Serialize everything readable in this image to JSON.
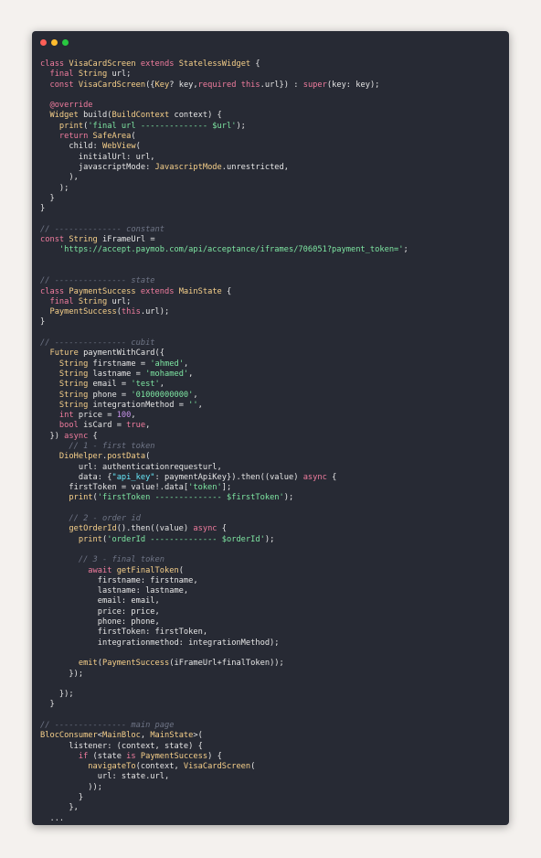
{
  "window": {
    "controls": [
      {
        "name": "close-dot",
        "color": "#ff5f57"
      },
      {
        "name": "minimize-dot",
        "color": "#febc2e"
      },
      {
        "name": "maximize-dot",
        "color": "#28c840"
      }
    ]
  },
  "colors": {
    "background": "#f4f1ee",
    "editor": "#272a34",
    "keyword": "#f07c9e",
    "type": "#f7d08a",
    "string": "#7ee6a2",
    "string_alt": "#67e8f9",
    "comment": "#6f7586",
    "number": "#c792ea",
    "plain": "#e6e6e6"
  },
  "code": {
    "lines": [
      [
        [
          "k",
          "class "
        ],
        [
          "t",
          "VisaCardScreen "
        ],
        [
          "k",
          "extends "
        ],
        [
          "t",
          "StatelessWidget "
        ],
        [
          "d",
          "{"
        ]
      ],
      [
        [
          "k",
          "  final "
        ],
        [
          "t",
          "String "
        ],
        [
          "d",
          "url;"
        ]
      ],
      [
        [
          "k",
          "  const "
        ],
        [
          "t",
          "VisaCardScreen"
        ],
        [
          "d",
          "({"
        ],
        [
          "t",
          "Key"
        ],
        [
          "d",
          "? key,"
        ],
        [
          "k",
          "required this"
        ],
        [
          "d",
          ".url}) : "
        ],
        [
          "k",
          "super"
        ],
        [
          "d",
          "(key: key);"
        ]
      ],
      [],
      [
        [
          "k",
          "  @override"
        ]
      ],
      [
        [
          "t",
          "  Widget "
        ],
        [
          "d",
          "build("
        ],
        [
          "t",
          "BuildContext "
        ],
        [
          "d",
          "context) {"
        ]
      ],
      [
        [
          "t",
          "    print"
        ],
        [
          "d",
          "("
        ],
        [
          "s",
          "'final url -------------- $url'"
        ],
        [
          "d",
          ");"
        ]
      ],
      [
        [
          "k",
          "    return "
        ],
        [
          "t",
          "SafeArea"
        ],
        [
          "d",
          "("
        ]
      ],
      [
        [
          "d",
          "      child: "
        ],
        [
          "t",
          "WebView"
        ],
        [
          "d",
          "("
        ]
      ],
      [
        [
          "d",
          "        initialUrl: url,"
        ]
      ],
      [
        [
          "d",
          "        javascriptMode: "
        ],
        [
          "t",
          "JavascriptMode"
        ],
        [
          "d",
          ".unrestricted,"
        ]
      ],
      [
        [
          "d",
          "      ),"
        ]
      ],
      [
        [
          "d",
          "    );"
        ]
      ],
      [
        [
          "d",
          "  }"
        ]
      ],
      [
        [
          "d",
          "}"
        ]
      ],
      [],
      [
        [
          "c",
          "// -------------- constant"
        ]
      ],
      [
        [
          "k",
          "const "
        ],
        [
          "t",
          "String "
        ],
        [
          "d",
          "iFrameUrl ="
        ]
      ],
      [
        [
          "s",
          "    'https://accept.paymob.com/api/acceptance/iframes/706051?payment_token='"
        ],
        [
          "d",
          ";"
        ]
      ],
      [],
      [],
      [
        [
          "c",
          "// --------------- state"
        ]
      ],
      [
        [
          "k",
          "class "
        ],
        [
          "t",
          "PaymentSuccess "
        ],
        [
          "k",
          "extends "
        ],
        [
          "t",
          "MainState "
        ],
        [
          "d",
          "{"
        ]
      ],
      [
        [
          "k",
          "  final "
        ],
        [
          "t",
          "String "
        ],
        [
          "d",
          "url;"
        ]
      ],
      [
        [
          "t",
          "  PaymentSuccess"
        ],
        [
          "d",
          "("
        ],
        [
          "k",
          "this"
        ],
        [
          "d",
          ".url);"
        ]
      ],
      [
        [
          "d",
          "}"
        ]
      ],
      [],
      [
        [
          "c",
          "// --------------- cubit"
        ]
      ],
      [
        [
          "t",
          "  Future "
        ],
        [
          "d",
          "paymentWithCard({"
        ]
      ],
      [
        [
          "t",
          "    String "
        ],
        [
          "d",
          "firstname = "
        ],
        [
          "s",
          "'ahmed'"
        ],
        [
          "d",
          ","
        ]
      ],
      [
        [
          "t",
          "    String "
        ],
        [
          "d",
          "lastname = "
        ],
        [
          "s",
          "'mohamed'"
        ],
        [
          "d",
          ","
        ]
      ],
      [
        [
          "t",
          "    String "
        ],
        [
          "d",
          "email = "
        ],
        [
          "s",
          "'test'"
        ],
        [
          "d",
          ","
        ]
      ],
      [
        [
          "t",
          "    String "
        ],
        [
          "d",
          "phone = "
        ],
        [
          "s",
          "'01000000000'"
        ],
        [
          "d",
          ","
        ]
      ],
      [
        [
          "t",
          "    String "
        ],
        [
          "d",
          "integrationMethod = "
        ],
        [
          "s",
          "''"
        ],
        [
          "d",
          ","
        ]
      ],
      [
        [
          "k",
          "    int "
        ],
        [
          "d",
          "price = "
        ],
        [
          "n",
          "100"
        ],
        [
          "d",
          ","
        ]
      ],
      [
        [
          "k",
          "    bool "
        ],
        [
          "d",
          "isCard = "
        ],
        [
          "k",
          "true"
        ],
        [
          "d",
          ","
        ]
      ],
      [
        [
          "d",
          "  }) "
        ],
        [
          "k",
          "async "
        ],
        [
          "d",
          "{"
        ]
      ],
      [
        [
          "c",
          "      // 1 - first token"
        ]
      ],
      [
        [
          "t",
          "    DioHelper"
        ],
        [
          "d",
          "."
        ],
        [
          "t",
          "postData"
        ],
        [
          "d",
          "("
        ]
      ],
      [
        [
          "d",
          "        url: authenticationrequesturl,"
        ]
      ],
      [
        [
          "d",
          "        data: {"
        ],
        [
          "st",
          "\"api_key\""
        ],
        [
          "d",
          ": paymentApiKey}).then((value) "
        ],
        [
          "k",
          "async "
        ],
        [
          "d",
          "{"
        ]
      ],
      [
        [
          "d",
          "      firstToken = value!.data["
        ],
        [
          "s",
          "'token'"
        ],
        [
          "d",
          "];"
        ]
      ],
      [
        [
          "t",
          "      print"
        ],
        [
          "d",
          "("
        ],
        [
          "s",
          "'firstToken -------------- $firstToken'"
        ],
        [
          "d",
          ");"
        ]
      ],
      [],
      [
        [
          "c",
          "      // 2 - order id"
        ]
      ],
      [
        [
          "t",
          "      getOrderId"
        ],
        [
          "d",
          "().then((value) "
        ],
        [
          "k",
          "async "
        ],
        [
          "d",
          "{"
        ]
      ],
      [
        [
          "t",
          "        print"
        ],
        [
          "d",
          "("
        ],
        [
          "s",
          "'orderId -------------- $orderId'"
        ],
        [
          "d",
          ");"
        ]
      ],
      [],
      [
        [
          "c",
          "        // 3 - final token"
        ]
      ],
      [
        [
          "k",
          "          await "
        ],
        [
          "t",
          "getFinalToken"
        ],
        [
          "d",
          "("
        ]
      ],
      [
        [
          "d",
          "            firstname: firstname,"
        ]
      ],
      [
        [
          "d",
          "            lastname: lastname,"
        ]
      ],
      [
        [
          "d",
          "            email: email,"
        ]
      ],
      [
        [
          "d",
          "            price: price,"
        ]
      ],
      [
        [
          "d",
          "            phone: phone,"
        ]
      ],
      [
        [
          "d",
          "            firstToken: firstToken,"
        ]
      ],
      [
        [
          "d",
          "            integrationmethod: integrationMethod);"
        ]
      ],
      [],
      [
        [
          "t",
          "        emit"
        ],
        [
          "d",
          "("
        ],
        [
          "t",
          "PaymentSuccess"
        ],
        [
          "d",
          "(iFrameUrl+finalToken));"
        ]
      ],
      [
        [
          "d",
          "      });"
        ]
      ],
      [],
      [
        [
          "d",
          "    });"
        ]
      ],
      [
        [
          "d",
          "  }"
        ]
      ],
      [],
      [
        [
          "c",
          "// --------------- main page"
        ]
      ],
      [
        [
          "t",
          "BlocConsumer"
        ],
        [
          "d",
          "<"
        ],
        [
          "t",
          "MainBloc"
        ],
        [
          "d",
          ", "
        ],
        [
          "t",
          "MainState"
        ],
        [
          "d",
          ">("
        ]
      ],
      [
        [
          "d",
          "      listener: (context, state) {"
        ]
      ],
      [
        [
          "k",
          "        if "
        ],
        [
          "d",
          "(state "
        ],
        [
          "k",
          "is "
        ],
        [
          "t",
          "PaymentSuccess"
        ],
        [
          "d",
          ") {"
        ]
      ],
      [
        [
          "t",
          "          navigateTo"
        ],
        [
          "d",
          "(context, "
        ],
        [
          "t",
          "VisaCardScreen"
        ],
        [
          "d",
          "("
        ]
      ],
      [
        [
          "d",
          "            url: state.url,"
        ]
      ],
      [
        [
          "d",
          "          ));"
        ]
      ],
      [
        [
          "d",
          "        }"
        ]
      ],
      [
        [
          "d",
          "      },"
        ]
      ],
      [
        [
          "d",
          "  ..."
        ]
      ]
    ]
  }
}
